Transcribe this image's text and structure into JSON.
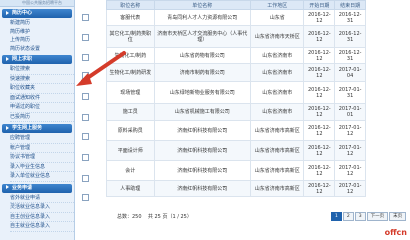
{
  "sidebar": {
    "top_text": "中国公共服务招聘平台",
    "sections": [
      {
        "title": "简历中心",
        "items": [
          "新建简历",
          "简历维护",
          "上传简历",
          "简历状态设置"
        ]
      },
      {
        "title": "网上求职",
        "items": [
          "职位搜索",
          "快速搜索",
          "职位收藏夹",
          "面试通知收件",
          "申请过的职位",
          "已投简历"
        ]
      },
      {
        "title": "学生网上服务",
        "items": [
          "应聘管理",
          "帐户管理",
          "协议书管理",
          "录入毕业生信息",
          "录入单位就业信息"
        ]
      },
      {
        "title": "业务申请",
        "items": [
          "省外就业申请",
          "灵活就业信息录入",
          "自主创业信息录入",
          "自主就业信息录入"
        ]
      }
    ]
  },
  "table": {
    "headers": [
      "职位名称",
      "单位名称",
      "工作地区",
      "开始日期",
      "结束日期"
    ],
    "rows": [
      {
        "job": "客服代表",
        "company": "青岛同利人才人力资源有限公司",
        "area": "山东省",
        "start": "2016-12-12",
        "end": "2016-12-31"
      },
      {
        "job": "其它化工/制药类职位",
        "company": "济南市天桥区人才交流服务中心（人事代理）",
        "area": "山东省济南市天桥区",
        "start": "2016-12-12",
        "end": "2016-12-31"
      },
      {
        "job": "生物化工/制药",
        "company": "山东省药物有限公司",
        "area": "山东省济南市",
        "start": "2016-12-12",
        "end": "2016-12-31"
      },
      {
        "job": "生物化工/制药研发",
        "company": "济南市制药有限公司",
        "area": "山东省济南市",
        "start": "2016-12-12",
        "end": "2017-01-04"
      },
      {
        "job": "现场管理",
        "company": "山东绿地新物业服务有限公司",
        "area": "山东省济南市",
        "start": "2016-12-12",
        "end": "2017-01-31"
      },
      {
        "job": "施工员",
        "company": "山东省机械施工有限公司",
        "area": "山东省济南市",
        "start": "2016-12-12",
        "end": "2017-01-01"
      },
      {
        "job": "原料采购员",
        "company": "济南红帆科技有限公司",
        "area": "山东省济南市高新区",
        "start": "2016-12-12",
        "end": "2017-01-12"
      },
      {
        "job": "平面设计师",
        "company": "济南红帆科技有限公司",
        "area": "山东省济南市高新区",
        "start": "2016-12-12",
        "end": "2017-01-12"
      },
      {
        "job": "会计",
        "company": "济南红帆科技有限公司",
        "area": "山东省济南市高新区",
        "start": "2016-12-12",
        "end": "2017-01-12"
      },
      {
        "job": "人事助理",
        "company": "济南红帆科技有限公司",
        "area": "山东省济南市高新区",
        "start": "2016-12-12",
        "end": "2017-01-12"
      }
    ]
  },
  "pager": {
    "total_text": "总数：250",
    "pages_text": "共 25 页（1 / 25）",
    "buttons": [
      "1",
      "2",
      "3",
      "下一页",
      "末页"
    ]
  },
  "watermark": "offcn",
  "colors": {
    "header_blue": "#1f62ad",
    "arrow_red": "#d43b2a",
    "link_blue": "#1e4f8a"
  }
}
